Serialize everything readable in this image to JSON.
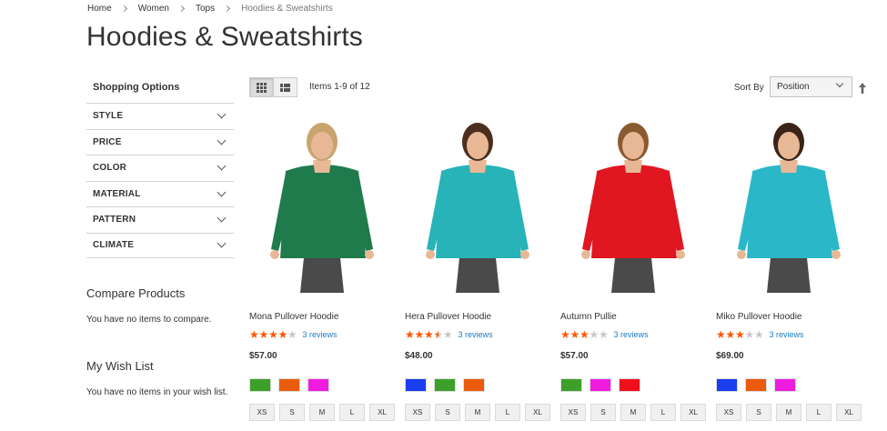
{
  "breadcrumb": {
    "items": [
      "Home",
      "Women",
      "Tops",
      "Hoodies & Sweatshirts"
    ]
  },
  "page_title": "Hoodies & Sweatshirts",
  "sidebar": {
    "title": "Shopping Options",
    "filters": [
      "STYLE",
      "PRICE",
      "COLOR",
      "MATERIAL",
      "PATTERN",
      "CLIMATE"
    ],
    "compare_title": "Compare Products",
    "compare_text": "You have no items to compare.",
    "wishlist_title": "My Wish List",
    "wishlist_text": "You have no items in your wish list."
  },
  "toolbar": {
    "modes": [
      "grid-icon",
      "list-icon"
    ],
    "amount": "Items 1-9 of 12",
    "sort_label": "Sort By",
    "sort_value": "Position",
    "sort_direction_icon": "arrow-up-icon"
  },
  "products": [
    {
      "name": "Mona Pullover Hoodie",
      "rating": 4,
      "reviews": "3 reviews",
      "price": "$57.00",
      "top_color": "#1f7a4c",
      "hair_color": "#c9a46e",
      "swatches": [
        "#3ca02a",
        "#eb5b0c",
        "#ef1ce0"
      ],
      "sizes": [
        "XS",
        "S",
        "M",
        "L",
        "XL"
      ]
    },
    {
      "name": "Hera Pullover Hoodie",
      "rating": 3.5,
      "reviews": "3 reviews",
      "price": "$48.00",
      "top_color": "#28b3b8",
      "hair_color": "#4a2f1f",
      "swatches": [
        "#1a3ef0",
        "#3ca02a",
        "#eb5b0c"
      ],
      "sizes": [
        "XS",
        "S",
        "M",
        "L",
        "XL"
      ]
    },
    {
      "name": "Autumn Pullie",
      "rating": 3,
      "reviews": "3 reviews",
      "price": "$57.00",
      "top_color": "#e01620",
      "hair_color": "#8a5a30",
      "swatches": [
        "#3ca02a",
        "#ef1ce0",
        "#f0101b"
      ],
      "sizes": [
        "XS",
        "S",
        "M",
        "L",
        "XL"
      ]
    },
    {
      "name": "Miko Pullover Hoodie",
      "rating": 3,
      "reviews": "3 reviews",
      "price": "$69.00",
      "top_color": "#2ab8c8",
      "hair_color": "#3a2318",
      "swatches": [
        "#1a3ef0",
        "#eb5b0c",
        "#ef1ce0"
      ],
      "sizes": [
        "XS",
        "S",
        "M",
        "L",
        "XL"
      ]
    }
  ],
  "colors": {
    "star_filled": "#ff5501",
    "star_empty": "#c7c7c7",
    "link": "#1979c3"
  }
}
